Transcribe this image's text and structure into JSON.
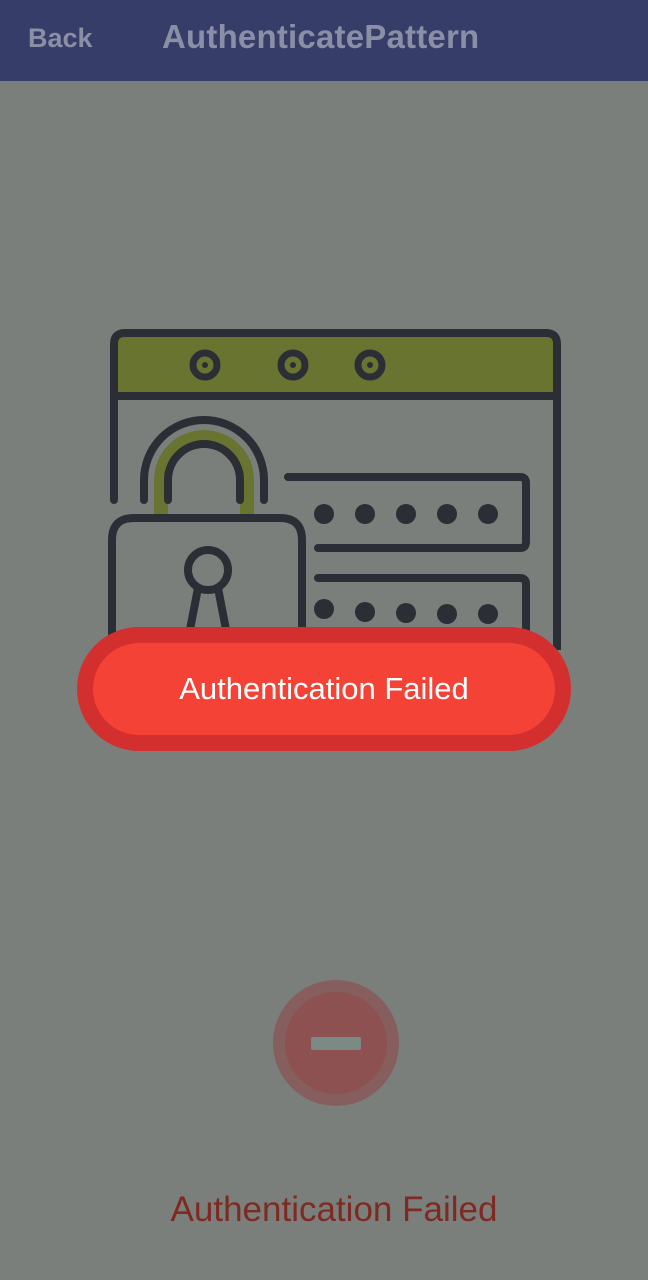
{
  "header": {
    "back_label": "Back",
    "title": "AuthenticatePattern"
  },
  "illustration": {
    "icon": "browser-lock-password-icon"
  },
  "toast": {
    "message": "Authentication Failed",
    "fill_color": "#f44336",
    "border_color": "#d32f2f"
  },
  "auth_button": {
    "icon": "minus-icon"
  },
  "status": {
    "message": "Authentication Failed",
    "color": "#7e2a22"
  }
}
